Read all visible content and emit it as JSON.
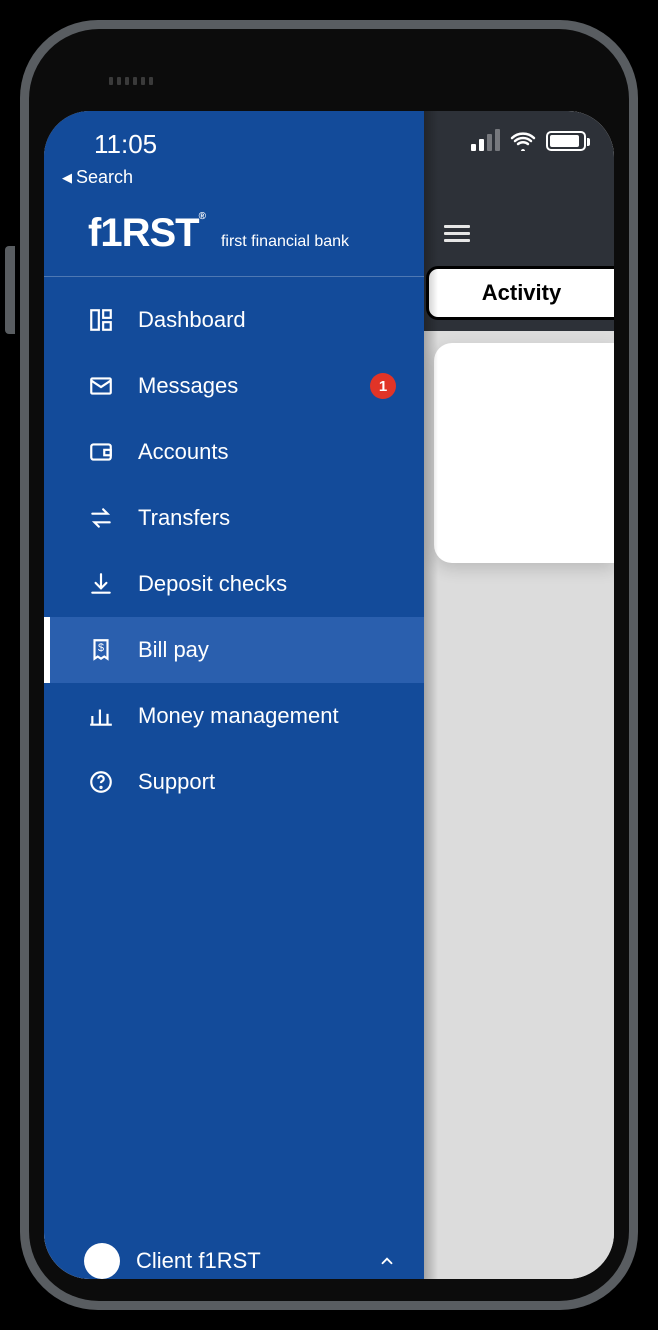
{
  "status": {
    "time": "11:05",
    "back_label": "Search"
  },
  "brand": {
    "logo": "f1RST",
    "reg": "®",
    "subtitle": "first financial bank"
  },
  "nav": {
    "items": [
      {
        "icon": "dashboard-icon",
        "label": "Dashboard",
        "badge": null,
        "active": false
      },
      {
        "icon": "messages-icon",
        "label": "Messages",
        "badge": "1",
        "active": false
      },
      {
        "icon": "accounts-icon",
        "label": "Accounts",
        "badge": null,
        "active": false
      },
      {
        "icon": "transfers-icon",
        "label": "Transfers",
        "badge": null,
        "active": false
      },
      {
        "icon": "deposit-icon",
        "label": "Deposit checks",
        "badge": null,
        "active": false
      },
      {
        "icon": "billpay-icon",
        "label": "Bill pay",
        "badge": null,
        "active": true
      },
      {
        "icon": "money-mgmt-icon",
        "label": "Money management",
        "badge": null,
        "active": false
      },
      {
        "icon": "support-icon",
        "label": "Support",
        "badge": null,
        "active": false
      }
    ]
  },
  "user": {
    "name": "Client f1RST"
  },
  "underpage": {
    "tab_label": "Activity"
  }
}
